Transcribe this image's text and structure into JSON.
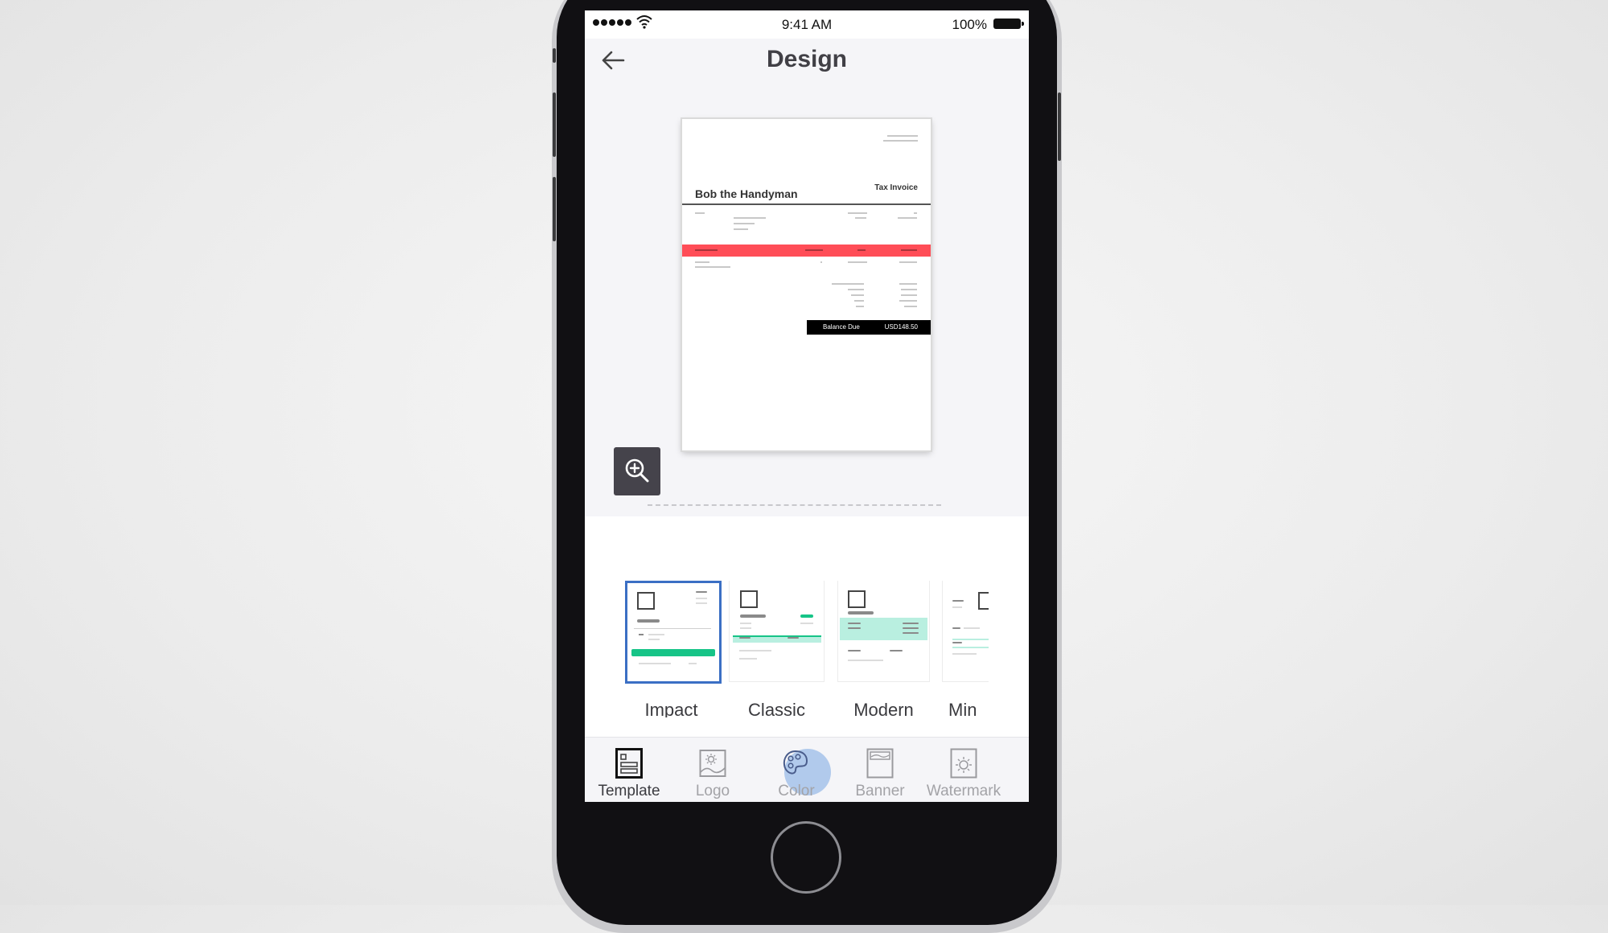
{
  "status_bar": {
    "signal_dots": 5,
    "time": "9:41 AM",
    "battery_percent": "100%"
  },
  "nav": {
    "back_icon": "arrow-left-icon",
    "title": "Design"
  },
  "invoice_preview": {
    "business_name": "Bob the Handyman",
    "document_title": "Tax Invoice",
    "balance_due_label": "Balance Due",
    "balance_due_value": "USD148.50",
    "table_header_color": "#ff4d57"
  },
  "zoom_button": {
    "icon": "zoom-in-icon"
  },
  "templates": {
    "selected": "Impact",
    "items": [
      {
        "label": "Impact",
        "accent": "#16c487"
      },
      {
        "label": "Classic",
        "accent": "#16c487"
      },
      {
        "label": "Modern",
        "accent": "#b9efe0"
      },
      {
        "label": "Min",
        "accent": "#b9efe0"
      }
    ]
  },
  "tabbar": {
    "active": "Template",
    "items": [
      {
        "label": "Template",
        "icon": "template-icon"
      },
      {
        "label": "Logo",
        "icon": "logo-image-icon"
      },
      {
        "label": "Color",
        "icon": "palette-icon"
      },
      {
        "label": "Banner",
        "icon": "banner-icon"
      },
      {
        "label": "Watermark",
        "icon": "watermark-icon"
      }
    ]
  },
  "colors": {
    "selection_border": "#3b6fc4",
    "zoom_button_bg": "#45434b",
    "title_text": "#414046"
  }
}
